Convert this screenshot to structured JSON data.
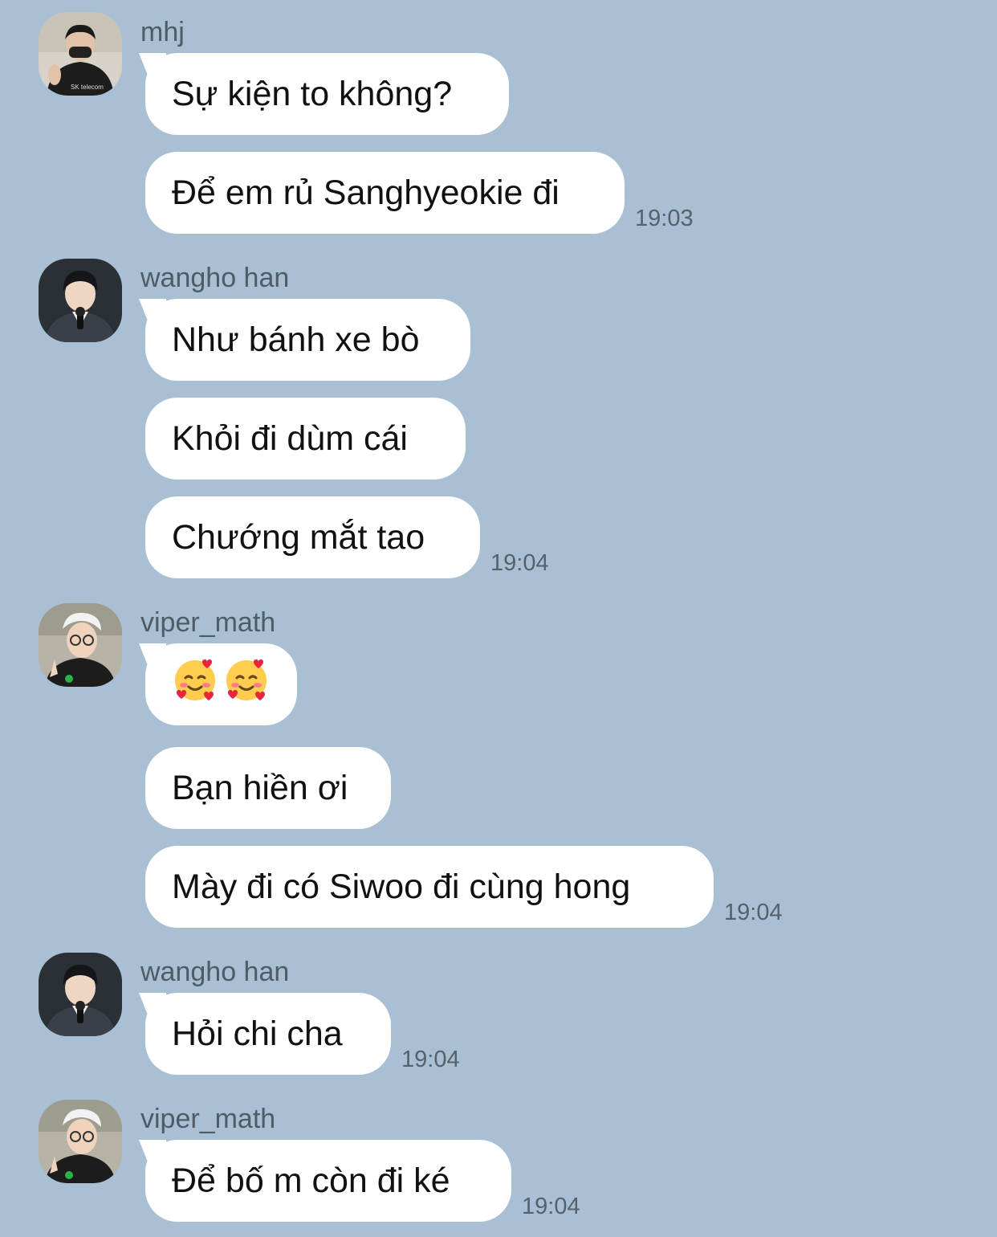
{
  "groups": [
    {
      "sender": "mhj",
      "avatar": "profile-photo-avatar",
      "messages": [
        "Sự kiện to không?",
        "Để em rủ Sanghyeokie đi"
      ],
      "time": "19:03"
    },
    {
      "sender": "wangho han",
      "avatar": "profile-photo-avatar",
      "messages": [
        "Như bánh xe bò",
        "Khỏi đi dùm cái",
        "Chướng mắt tao"
      ],
      "time": "19:04"
    },
    {
      "sender": "viper_math",
      "avatar": "profile-photo-avatar",
      "messages": [
        "🥰🥰",
        "Bạn hiền ơi",
        "Mày đi có Siwoo đi cùng hong"
      ],
      "time": "19:04"
    },
    {
      "sender": "wangho han",
      "avatar": "profile-photo-avatar",
      "messages": [
        "Hỏi chi cha"
      ],
      "time": "19:04"
    },
    {
      "sender": "viper_math",
      "avatar": "profile-photo-avatar",
      "messages": [
        "Để bố m còn đi ké"
      ],
      "time": "19:04"
    }
  ],
  "icons": {
    "smiling-face-with-hearts": "🥰"
  },
  "colors": {
    "background": "#a9bfd3",
    "bubble": "#ffffff",
    "text": "#111111",
    "meta_text": "#56616c"
  }
}
